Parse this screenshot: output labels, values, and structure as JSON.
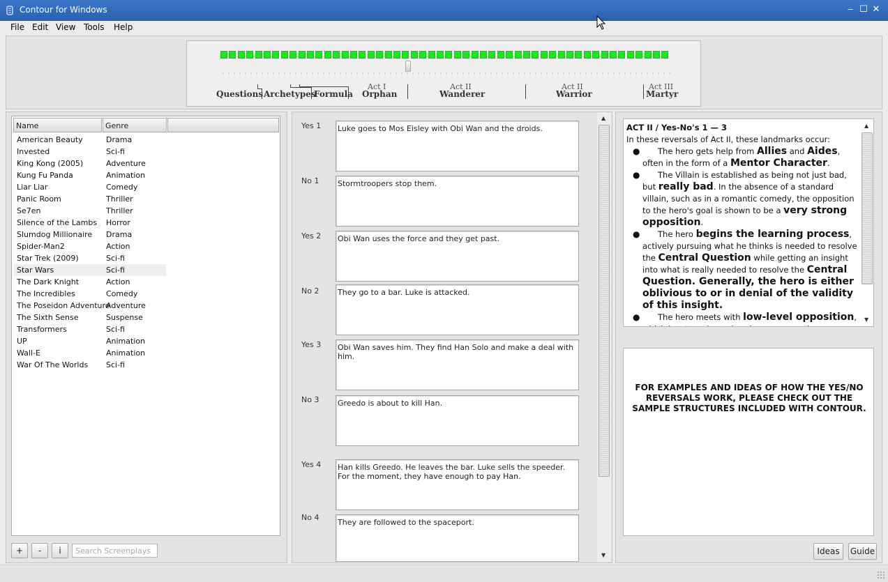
{
  "window": {
    "title": "Contour for Windows",
    "controls": [
      "‒",
      "☐",
      "✕"
    ]
  },
  "menu": [
    "File",
    "Edit",
    "View",
    "Tools",
    "Help"
  ],
  "structure": {
    "beat_count": 52,
    "slider_position": 0.42,
    "segments": [
      "Questions",
      "Archetypes",
      "Formula"
    ],
    "acts": [
      {
        "act": "Act I",
        "name": "Orphan"
      },
      {
        "act": "Act II",
        "name": "Wanderer"
      },
      {
        "act": "Act II",
        "name": "Warrior"
      },
      {
        "act": "Act III",
        "name": "Martyr"
      }
    ],
    "colors": {
      "beat": "#1ee61e"
    }
  },
  "screenplays": {
    "columns": [
      "Name",
      "Genre"
    ],
    "rows": [
      [
        "American Beauty",
        "Drama"
      ],
      [
        "Invested",
        "Sci-fi"
      ],
      [
        "King Kong (2005)",
        "Adventure"
      ],
      [
        "Kung Fu Panda",
        "Animation"
      ],
      [
        "Liar Liar",
        "Comedy"
      ],
      [
        "Panic Room",
        "Thriller"
      ],
      [
        "Se7en",
        "Thriller"
      ],
      [
        "Silence of the Lambs",
        "Horror"
      ],
      [
        "Slumdog Millionaire",
        "Drama"
      ],
      [
        "Spider-Man2",
        "Action"
      ],
      [
        "Star Trek (2009)",
        "Sci-fi"
      ],
      [
        "Star Wars",
        "Sci-fi"
      ],
      [
        "The Dark Knight",
        "Action"
      ],
      [
        "The Incredibles",
        "Comedy"
      ],
      [
        "The Poseidon Adventure",
        "Adventure"
      ],
      [
        "The Sixth Sense",
        "Suspense"
      ],
      [
        "Transformers",
        "Sci-fi"
      ],
      [
        "UP",
        "Animation"
      ],
      [
        "Wall-E",
        "Animation"
      ],
      [
        "War Of The Worlds",
        "Sci-fi"
      ]
    ],
    "selected": "Star Wars",
    "add_label": "+",
    "remove_label": "-",
    "info_label": "i",
    "search_placeholder": "Search Screenplays"
  },
  "reversals": [
    {
      "label": "Yes 1",
      "text": "Luke goes to Mos Eisley with Obi Wan and the droids."
    },
    {
      "label": "No 1",
      "text": "Stormtroopers stop them."
    },
    {
      "label": "Yes 2",
      "text": "Obi Wan uses the force and they get past."
    },
    {
      "label": "No 2",
      "text": "They go to a bar. Luke is attacked."
    },
    {
      "label": "Yes 3",
      "text": "Obi Wan saves him. They find Han Solo and make a deal with him."
    },
    {
      "label": "No 3",
      "text": "Greedo is about to kill Han."
    },
    {
      "label": "Yes 4",
      "text": "Han kills Greedo. He leaves the bar. Luke sells the speeder. For the moment, they have enough to pay Han."
    },
    {
      "label": "No 4",
      "text": "They are followed to the spaceport."
    }
  ],
  "guide": {
    "heading": "ACT II / Yes-No's 1 — 3",
    "intro": "In these reversals of Act II, these landmarks occur:",
    "b1": {
      "p1": "The hero gets help from ",
      "s1": "Allies",
      "p2": " and ",
      "s2": "Aides",
      "p3": ", often in the form of a ",
      "s3": "Mentor Character",
      "p4": "."
    },
    "b2": {
      "p1": "The Villain is established as being not just bad, but ",
      "s1": "really bad",
      "p2": ". In the absence of a standard villain, such as in a romantic comedy, the opposition to the hero's goal is shown to be a ",
      "s2": "very strong opposition",
      "p3": "."
    },
    "b3": {
      "p1": "The hero ",
      "s1": "begins the learning process",
      "p2": ", actively pursuing what he thinks is needed to resolve the ",
      "s2": "Central Question",
      "p3": " while getting an insight into what is really needed to resolve the ",
      "s3": "Central Question.",
      "s4": " Generally, the hero is either oblivious to or in denial of the validity of this insight."
    },
    "b4": {
      "p1": "The hero meets with ",
      "s1": "low-level opposition",
      "p2": ", which he struggles to barely overcome; these encounters can be considered \"training exercises\" or \"dry runs\" for the skills and/or insights that the hero will ultimately"
    }
  },
  "ideas": {
    "text": "FOR EXAMPLES AND IDEAS OF HOW THE YES/NO REVERSALS WORK, PLEASE CHECK OUT THE SAMPLE STRUCTURES INCLUDED WITH CONTOUR.",
    "ideas_button": "Ideas",
    "guide_button": "Guide"
  }
}
